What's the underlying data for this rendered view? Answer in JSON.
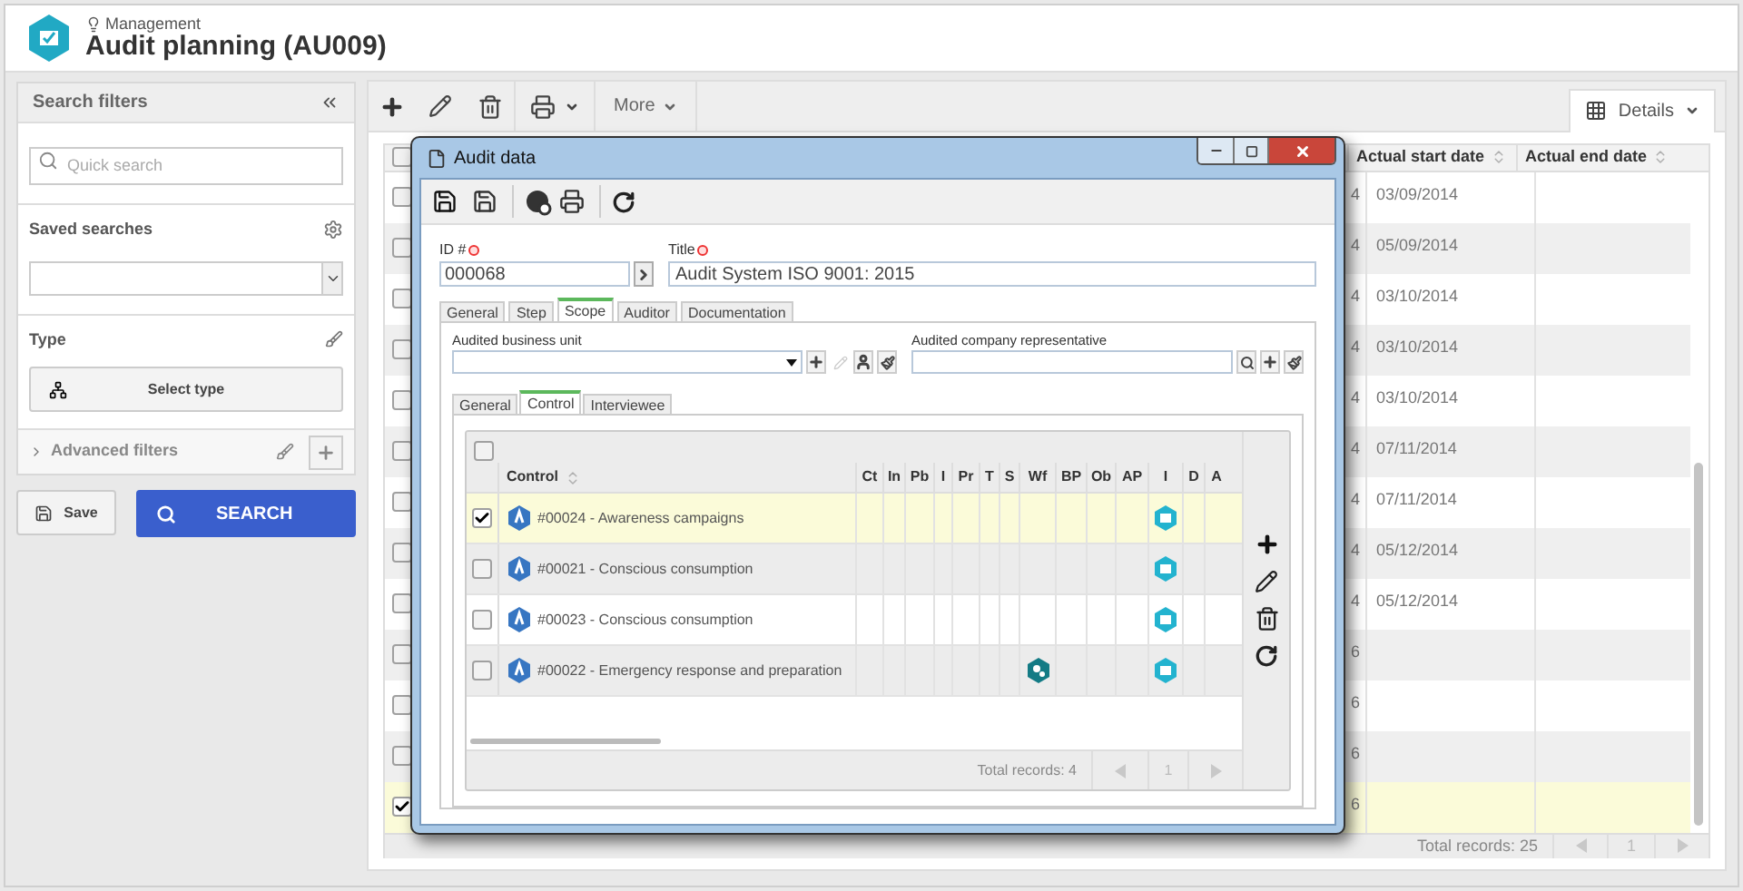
{
  "header": {
    "module": "Management",
    "title": "Audit planning (AU009)"
  },
  "filters": {
    "title": "Search filters",
    "quick_search": {
      "placeholder": "Quick search"
    },
    "saved_searches": {
      "label": "Saved searches"
    },
    "type": {
      "label": "Type",
      "button": "Select type"
    },
    "advanced": {
      "label": "Advanced filters",
      "expanded": false
    },
    "save": "Save",
    "search": "SEARCH"
  },
  "toolbar": {
    "more": "More",
    "view": "Details"
  },
  "grid": {
    "select_all": false,
    "columns": [
      "Actual start date",
      "Actual end date"
    ],
    "rows": [
      {
        "column_3": "4",
        "actual_start_date": "03/09/2014",
        "checked": false
      },
      {
        "column_3": "4",
        "actual_start_date": "05/09/2014",
        "checked": false
      },
      {
        "column_3": "4",
        "actual_start_date": "03/10/2014",
        "checked": false
      },
      {
        "column_3": "4",
        "actual_start_date": "03/10/2014",
        "checked": false
      },
      {
        "column_3": "4",
        "actual_start_date": "03/10/2014",
        "checked": false
      },
      {
        "column_3": "4",
        "actual_start_date": "07/11/2014",
        "checked": false
      },
      {
        "column_3": "4",
        "actual_start_date": "07/11/2014",
        "checked": false
      },
      {
        "column_3": "4",
        "actual_start_date": "05/12/2014",
        "checked": false
      },
      {
        "column_3": "4",
        "actual_start_date": "05/12/2014",
        "checked": false
      },
      {
        "column_3": "6",
        "checked": false
      },
      {
        "column_3": "6",
        "checked": false
      },
      {
        "column_3": "6",
        "checked": false
      },
      {
        "column_3": "6",
        "checked": true
      }
    ],
    "total": "Total records: 25",
    "page": "1"
  },
  "dialog": {
    "title": "Audit data",
    "id": {
      "label": "ID #",
      "value": "000068"
    },
    "title_field": {
      "label": "Title",
      "value": "Audit System ISO 9001: 2015"
    },
    "tabs": [
      {
        "label": "General",
        "selected": false
      },
      {
        "label": "Step",
        "selected": false
      },
      {
        "label": "Scope",
        "selected": true
      },
      {
        "label": "Auditor",
        "selected": false
      },
      {
        "label": "Documentation",
        "selected": false
      }
    ],
    "business_unit": {
      "label": "Audited business unit"
    },
    "representative": {
      "label": "Audited company representative"
    },
    "inner_tabs": [
      {
        "label": "General",
        "selected": false
      },
      {
        "label": "Control",
        "selected": true
      },
      {
        "label": "Interviewee",
        "selected": false
      }
    ],
    "controls": {
      "select_all": false,
      "columns": [
        "Control",
        "Ct",
        "In",
        "Pb",
        "I",
        "Pr",
        "T",
        "S",
        "Wf",
        "BP",
        "Ob",
        "AP",
        "I",
        "D",
        "A"
      ],
      "rows": [
        {
          "label": "#00024 - Awareness campaigns",
          "checked": true,
          "wf_icon": false,
          "i_icon": true
        },
        {
          "label": "#00021 - Conscious consumption",
          "checked": false,
          "wf_icon": false,
          "i_icon": true
        },
        {
          "label": "#00023 - Conscious consumption",
          "checked": false,
          "wf_icon": false,
          "i_icon": true
        },
        {
          "label": "#00022 - Emergency response and preparation",
          "checked": false,
          "wf_icon": true,
          "i_icon": true
        }
      ],
      "total": "Total records: 4",
      "page": "1"
    }
  }
}
